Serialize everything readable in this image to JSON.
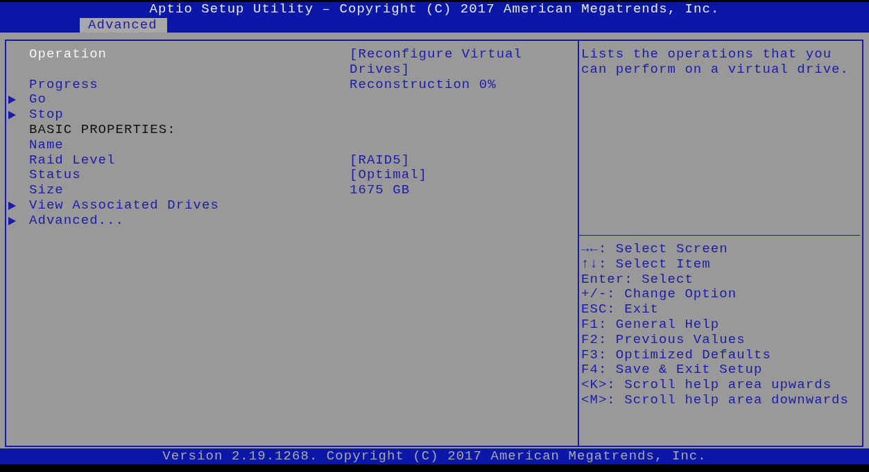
{
  "title": "Aptio Setup Utility – Copyright (C) 2017 American Megatrends, Inc.",
  "tabs": [
    {
      "label": "Advanced",
      "selected": true
    }
  ],
  "items": [
    {
      "kind": "setting",
      "label": "Operation",
      "value": "[Reconfigure Virtual Drives]",
      "selected": true
    },
    {
      "kind": "setting",
      "label": "Progress",
      "value": "Reconstruction 0%",
      "selected": false
    },
    {
      "kind": "submenu",
      "label": "Go",
      "selected": false
    },
    {
      "kind": "submenu",
      "label": "Stop",
      "selected": false
    },
    {
      "kind": "heading",
      "label": "BASIC PROPERTIES:",
      "selected": false
    },
    {
      "kind": "setting",
      "label": "Name",
      "selected": false
    },
    {
      "kind": "setting",
      "label": "Raid Level",
      "value": "[RAID5]",
      "selected": false
    },
    {
      "kind": "setting",
      "label": "Status",
      "value": "[Optimal]",
      "selected": false
    },
    {
      "kind": "setting",
      "label": "Size",
      "value": "1675 GB",
      "selected": false
    },
    {
      "kind": "submenu",
      "label": "View Associated Drives",
      "selected": false
    },
    {
      "kind": "submenu",
      "label": "Advanced...",
      "selected": false
    }
  ],
  "help_text": "Lists the operations that you can perform on a virtual drive.",
  "key_help": [
    "→←: Select Screen",
    "↑↓: Select Item",
    "Enter: Select",
    "+/-: Change Option",
    "ESC: Exit",
    "F1: General Help",
    "F2: Previous Values",
    "F3: Optimized Defaults",
    "F4: Save & Exit Setup",
    "<K>: Scroll help area upwards",
    "<M>: Scroll help area downwards"
  ],
  "footer": "Version 2.19.1268. Copyright (C) 2017 American Megatrends, Inc."
}
